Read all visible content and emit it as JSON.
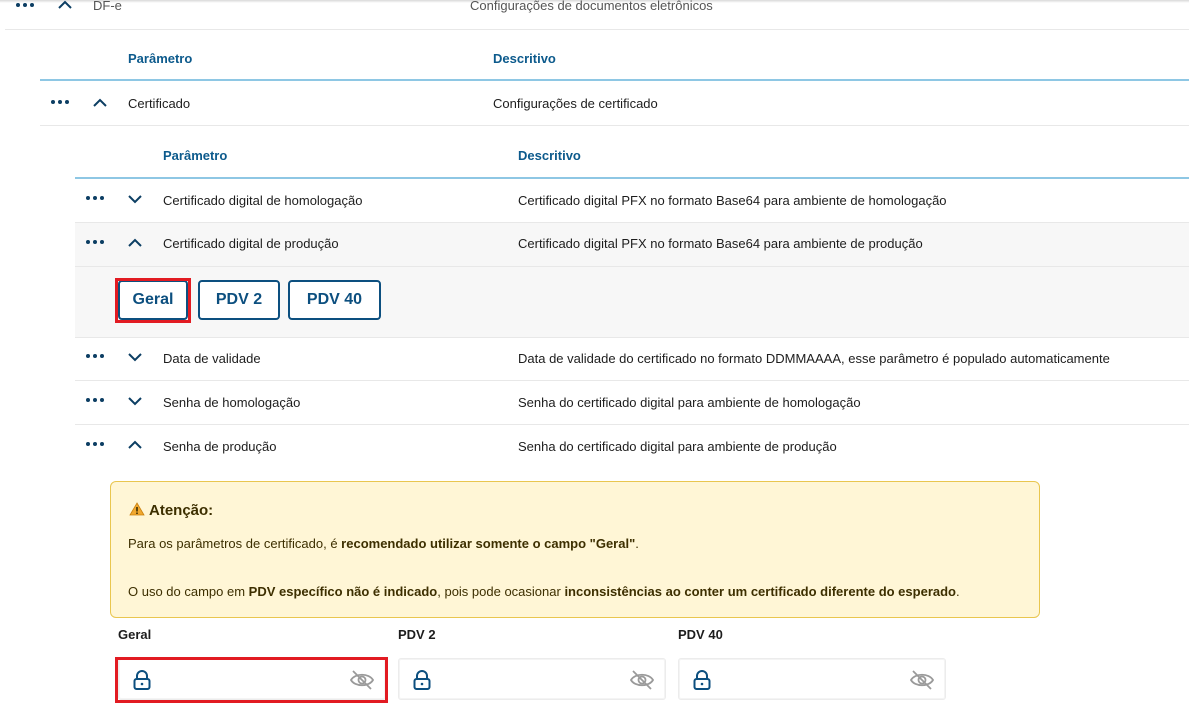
{
  "top": {
    "name": "DF-e",
    "description": "Configurações de documentos eletrônicos"
  },
  "level1": {
    "headers": {
      "param": "Parâmetro",
      "desc": "Descritivo"
    },
    "row": {
      "name": "Certificado",
      "description": "Configurações de certificado"
    }
  },
  "level2": {
    "headers": {
      "param": "Parâmetro",
      "desc": "Descritivo"
    },
    "rows": [
      {
        "name": "Certificado digital de homologação",
        "description": "Certificado digital PFX no formato Base64 para ambiente de homologação",
        "expanded": false
      },
      {
        "name": "Certificado digital de produção",
        "description": "Certificado digital PFX no formato Base64 para ambiente de produção",
        "expanded": true
      },
      {
        "name": "Data de validade",
        "description": "Data de validade do certificado no formato DDMMAAAA, esse parâmetro é populado automaticamente",
        "expanded": false
      },
      {
        "name": "Senha de homologação",
        "description": "Senha do certificado digital para ambiente de homologação",
        "expanded": false
      },
      {
        "name": "Senha de produção",
        "description": "Senha do certificado digital para ambiente de produção",
        "expanded": true
      }
    ]
  },
  "pdv_buttons": [
    "Geral",
    "PDV 2",
    "PDV 40"
  ],
  "alert": {
    "title": "Atenção:",
    "line1_a": "Para os parâmetros de certificado, é ",
    "line1_b": "recomendado utilizar somente o campo \"Geral\"",
    "line1_c": ".",
    "line2_a": "O uso do campo em ",
    "line2_b": "PDV específico não é indicado",
    "line2_c": ", pois pode ocasionar ",
    "line2_d": "inconsistências ao conter um certificado diferente do esperado",
    "line2_e": "."
  },
  "fields": [
    {
      "label": "Geral",
      "value": ""
    },
    {
      "label": "PDV 2",
      "value": ""
    },
    {
      "label": "PDV 40",
      "value": ""
    }
  ],
  "colors": {
    "accent": "#0c4f7f",
    "header_text": "#0c5a8c",
    "highlight": "#e21b22",
    "alert_bg": "#fff6d6"
  }
}
